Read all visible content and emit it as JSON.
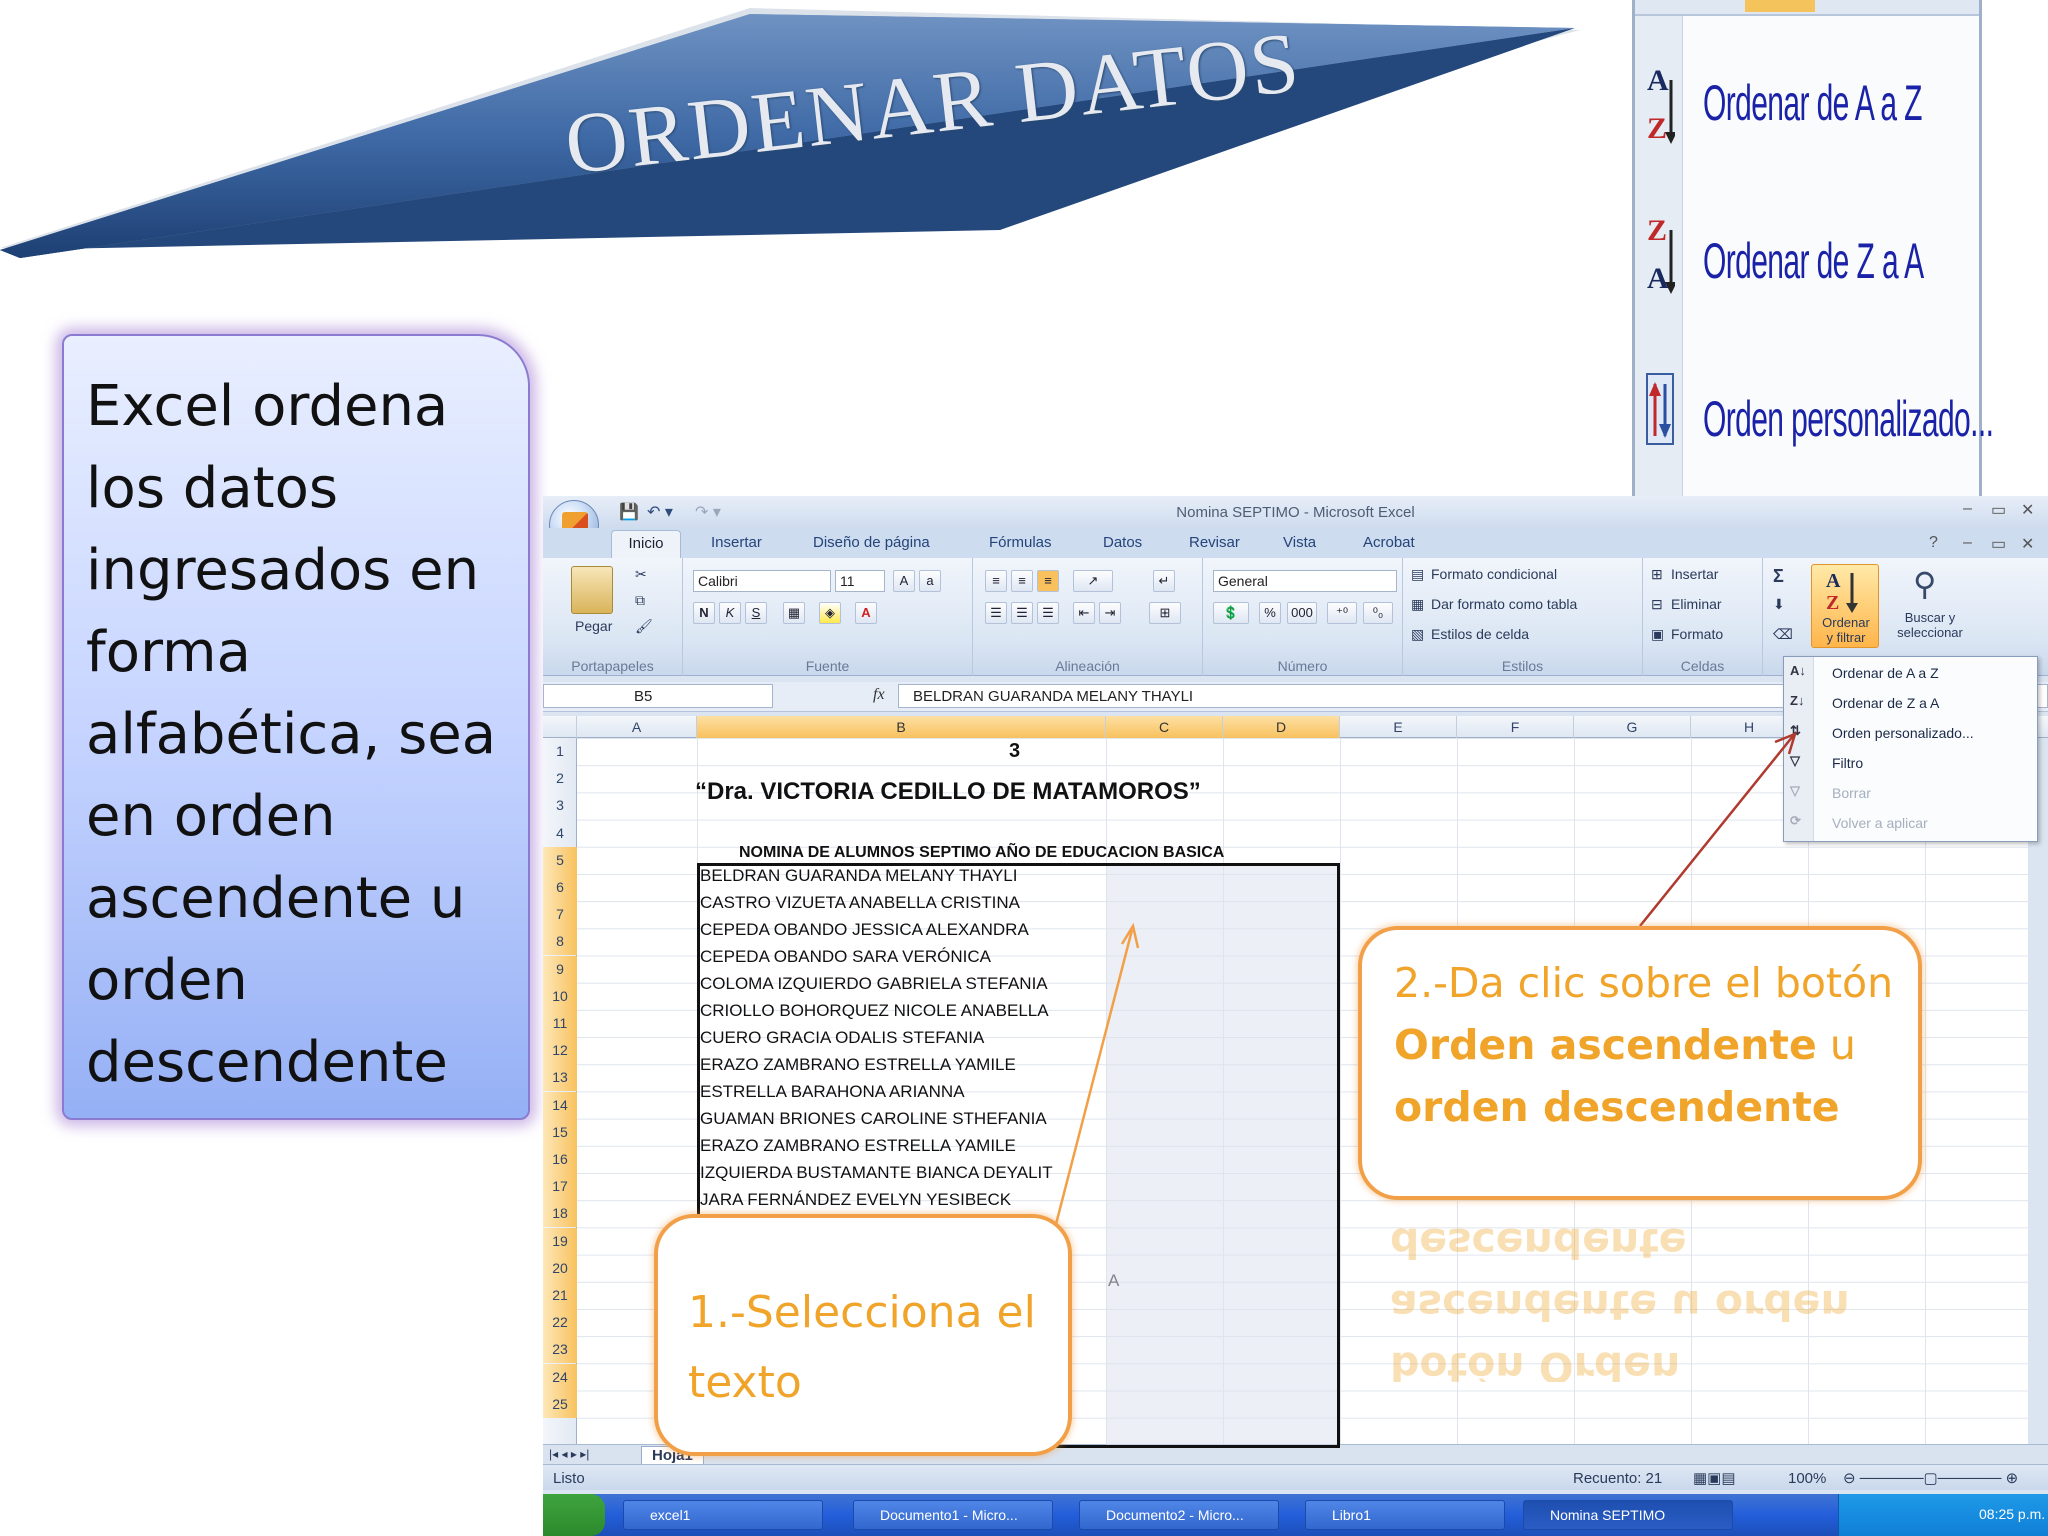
{
  "slide": {
    "title": "ORDENAR DATOS",
    "info_text": "Excel ordena los datos ingresados en forma alfabética, sea en orden ascendente u orden descendente",
    "callout1": "1.-Selecciona el texto",
    "callout2": {
      "part1": "2.-Da clic sobre el botón ",
      "bold1": "Orden ascendente",
      "part2": " u ",
      "bold2": "orden descendente"
    },
    "reflection_lines": [
      "descendente",
      "ascendente u orden",
      "botón Orden"
    ]
  },
  "zoom_menu": {
    "items": [
      {
        "label": "Ordenar de A a Z",
        "icon": "sort-az-icon"
      },
      {
        "label": "Ordenar de Z a A",
        "icon": "sort-za-icon"
      },
      {
        "label": "Orden personalizado...",
        "icon": "custom-sort-icon"
      }
    ]
  },
  "excel": {
    "window_title": "Nomina SEPTIMO - Microsoft Excel",
    "tabs": [
      "Inicio",
      "Insertar",
      "Diseño de página",
      "Fórmulas",
      "Datos",
      "Revisar",
      "Vista",
      "Acrobat"
    ],
    "ribbon": {
      "clipboard": {
        "paste": "Pegar",
        "label": "Portapapeles"
      },
      "font": {
        "name": "Calibri",
        "size": "11",
        "label": "Fuente",
        "bold": "N",
        "italic": "K",
        "underline": "S"
      },
      "alignment": {
        "label": "Alineación"
      },
      "number": {
        "format": "General",
        "label": "Número",
        "percent": "%",
        "thousands": "000"
      },
      "styles": {
        "cond": "Formato condicional",
        "table": "Dar formato como tabla",
        "cell": "Estilos de celda",
        "label": "Estilos"
      },
      "cells": {
        "insert": "Insertar",
        "delete": "Eliminar",
        "format": "Formato",
        "label": "Celdas"
      },
      "editing": {
        "sort": "Ordenar y filtrar",
        "sort1": "Ordenar",
        "sort2": "y filtrar",
        "find1": "Buscar y",
        "find2": "seleccionar",
        "sigma": "Σ"
      }
    },
    "name_box": "B5",
    "formula": "BELDRAN GUARANDA MELANY THAYLI",
    "columns": [
      "A",
      "B",
      "C",
      "D",
      "E",
      "F",
      "G",
      "H"
    ],
    "rows": [
      "1",
      "2",
      "3",
      "4",
      "5",
      "6",
      "7",
      "8",
      "9",
      "10",
      "11",
      "12",
      "13",
      "14",
      "15",
      "16",
      "17",
      "18",
      "19",
      "20",
      "21",
      "22",
      "23",
      "24",
      "25"
    ],
    "cells": {
      "r1": "3",
      "r2": "“Dra. VICTORIA CEDILLO DE MATAMOROS”",
      "r4": "NOMINA DE ALUMNOS SEPTIMO AÑO DE EDUCACION BASICA",
      "names": [
        "BELDRAN GUARANDA MELANY THAYLI",
        "CASTRO VIZUETA ANABELLA CRISTINA",
        "CEPEDA OBANDO JESSICA ALEXANDRA",
        "CEPEDA OBANDO SARA VERÓNICA",
        "COLOMA IZQUIERDO GABRIELA STEFANIA",
        "CRIOLLO BOHORQUEZ NICOLE ANABELLA",
        "CUERO GRACIA ODALIS STEFANIA",
        "ERAZO ZAMBRANO ESTRELLA YAMILE",
        "ESTRELLA BARAHONA ARIANNA",
        "GUAMAN BRIONES CAROLINE STHEFANIA",
        "ERAZO ZAMBRANO ESTRELLA YAMILE",
        "IZQUIERDA BUSTAMANTE BIANCA DEYALIT",
        "JARA FERNÁNDEZ EVELYN YESIBECK"
      ],
      "r20_tail": "A"
    },
    "dropdown": [
      {
        "label": "Ordenar de A a Z",
        "icon": "sort-az-icon",
        "enabled": true
      },
      {
        "label": "Ordenar de Z a A",
        "icon": "sort-za-icon",
        "enabled": true
      },
      {
        "label": "Orden personalizado...",
        "icon": "custom-sort-icon",
        "enabled": true
      },
      {
        "label": "Filtro",
        "icon": "filter-icon",
        "enabled": true
      },
      {
        "label": "Borrar",
        "icon": "clear-filter-icon",
        "enabled": false
      },
      {
        "label": "Volver a aplicar",
        "icon": "reapply-icon",
        "enabled": false
      }
    ],
    "sheet_tab": "Hoja1",
    "status": {
      "ready": "Listo",
      "count": "Recuento: 21",
      "zoom": "100%"
    },
    "taskbar": {
      "items": [
        "excel1",
        "Documento1 - Micro...",
        "Documento2 - Micro...",
        "Libro1",
        "Nomina SEPTIMO"
      ],
      "clock": "08:25 p.m."
    }
  },
  "colors": {
    "accent_orange": "#f0a42a",
    "banner_blue": "#2d5a96",
    "excel_blue": "#dbe5f1"
  }
}
